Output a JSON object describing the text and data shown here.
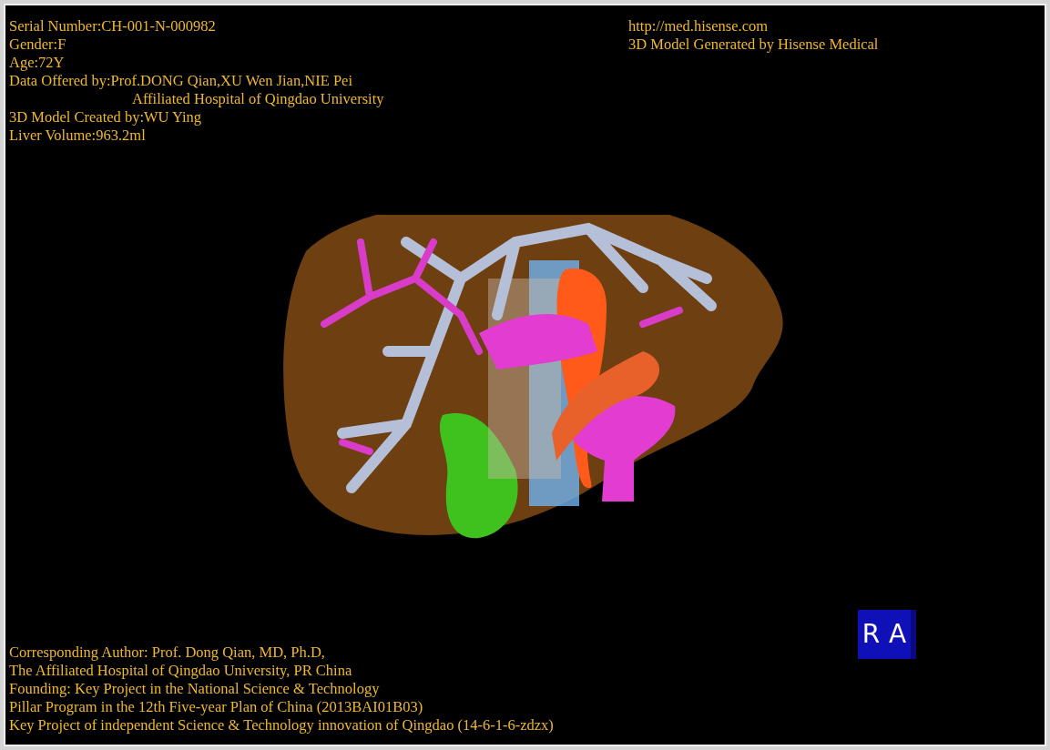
{
  "patient_info": [
    {
      "kind": "line",
      "text": "Serial Number:CH-001-N-000982"
    },
    {
      "kind": "line",
      "text": "Gender:F"
    },
    {
      "kind": "line",
      "text": "Age:72Y"
    },
    {
      "kind": "line",
      "text": "Data Offered by:Prof.DONG Qian,XU Wen Jian,NIE Pei"
    },
    {
      "kind": "continuation",
      "text": "Affiliated Hospital of Qingdao University"
    },
    {
      "kind": "line",
      "text": "3D Model Created by:WU Ying"
    },
    {
      "kind": "line",
      "text": "Liver Volume:963.2ml"
    }
  ],
  "credits": [
    "http://med.hisense.com",
    "3D Model Generated by Hisense Medical"
  ],
  "footer": [
    "Corresponding Author: Prof. Dong Qian, MD, Ph.D,",
    "The Affiliated Hospital of Qingdao University, PR China",
    "Founding: Key Project in the National Science & Technology",
    "Pillar Program in the 12th Five-year Plan of China (2013BAI01B03)",
    "Key Project of independent Science & Technology innovation of Qingdao (14-6-1-6-zdzx)"
  ],
  "orientation_cube": {
    "labels": [
      "R",
      "A"
    ]
  }
}
